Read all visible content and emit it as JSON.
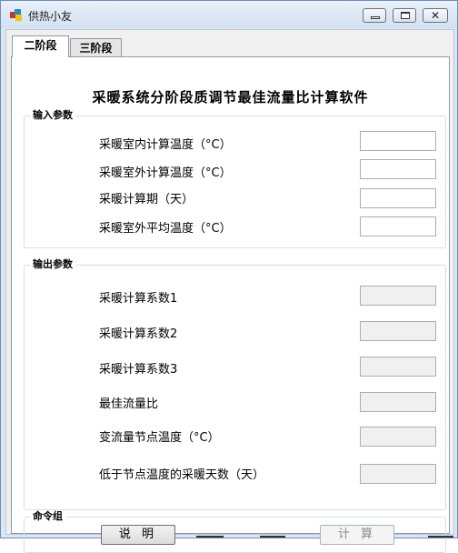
{
  "window": {
    "title": "供热小友"
  },
  "tabs": [
    {
      "label": "二阶段",
      "active": true
    },
    {
      "label": "三阶段",
      "active": false
    }
  ],
  "heading": "采暖系统分阶段质调节最佳流量比计算软件",
  "input_group": {
    "title": "输入参数",
    "fields": [
      {
        "label": "采暖室内计算温度（°C）",
        "value": ""
      },
      {
        "label": "采暖室外计算温度（°C）",
        "value": ""
      },
      {
        "label": "采暖计算期（天）",
        "value": ""
      },
      {
        "label": "采暖室外平均温度（°C）",
        "value": ""
      }
    ]
  },
  "output_group": {
    "title": "输出参数",
    "fields": [
      {
        "label": "采暖计算系数1",
        "value": ""
      },
      {
        "label": "采暖计算系数2",
        "value": ""
      },
      {
        "label": "采暖计算系数3",
        "value": ""
      },
      {
        "label": "最佳流量比",
        "value": ""
      },
      {
        "label": "变流量节点温度（°C）",
        "value": ""
      },
      {
        "label": "低于节点温度的采暖天数（天）",
        "value": ""
      }
    ]
  },
  "command_group": {
    "title": "命令组",
    "explain_label": "说 明",
    "calc_label": "计 算"
  },
  "colors": {
    "window_frame": "#dce7f3",
    "page_bg": "#ffffff",
    "readonly_field": "#f0f0f0"
  }
}
